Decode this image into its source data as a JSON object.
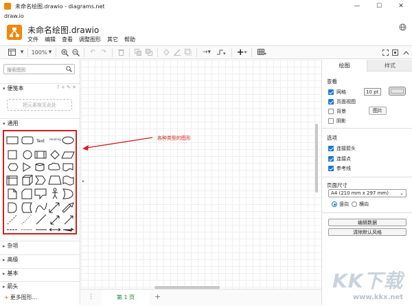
{
  "window": {
    "title": "未命名绘图.drawio - diagrams.net",
    "subtitle": "draw.io",
    "controls": {
      "minimize": "—",
      "maximize": "☐",
      "close": "✕"
    }
  },
  "header": {
    "filename": "未命名绘图.drawio",
    "menu": [
      "文件",
      "编辑",
      "查看",
      "调整图形",
      "其它",
      "帮助"
    ],
    "icons": [
      "drawio-logo-icon",
      "globe-icon"
    ]
  },
  "toolbar": {
    "zoom": "100%",
    "zoom_caret": "▾",
    "icons": [
      "view-toggle-icon",
      "zoom-in-icon",
      "zoom-out-icon",
      "undo-icon",
      "redo-icon",
      "delete-icon",
      "to-front-icon",
      "to-back-icon",
      "fill-color-icon",
      "line-color-icon",
      "shadow-icon",
      "connection-icon",
      "waypoint-icon",
      "insert-icon",
      "table-icon",
      "fullscreen-icon",
      "fit-icon",
      "collapse-icon"
    ]
  },
  "left_panel": {
    "search_placeholder": "搜索图形",
    "scratchpad": {
      "label": "便笺本",
      "tools": "? + ✎ ✕",
      "drop_hint": "把元素拖至此处"
    },
    "general": {
      "label": "通用"
    },
    "general_shape_text": {
      "text": "Text",
      "heading": "Heading"
    },
    "other_sections": [
      {
        "label": "杂项"
      },
      {
        "label": "高级"
      },
      {
        "label": "基本"
      },
      {
        "label": "箭头"
      }
    ],
    "more_shapes": "更多图形..."
  },
  "canvas": {
    "annotation": "各种类型的图形",
    "annotation_color": "#d41c1c"
  },
  "page_bar": {
    "dots": "⋮",
    "page_tab": "第 1 页",
    "add": "+"
  },
  "format_panel": {
    "tabs": [
      "绘图",
      "样式"
    ],
    "view": {
      "heading": "查看",
      "grid_label": "网格",
      "grid_checked": true,
      "grid_size": "10 pt",
      "page_view_label": "页面视图",
      "page_view_checked": true,
      "background_label": "背景",
      "background_checked": false,
      "image_button": "图片",
      "shadow_label": "阴影",
      "shadow_checked": false
    },
    "options": {
      "heading": "选项",
      "items": [
        {
          "label": "连接箭头",
          "checked": true
        },
        {
          "label": "连接点",
          "checked": true
        },
        {
          "label": "参考线",
          "checked": true
        }
      ]
    },
    "paper": {
      "heading": "页面尺寸",
      "size": "A4 (210 mm x 297 mm)",
      "portrait": "竖向",
      "landscape": "横向",
      "orientation": "portrait"
    },
    "buttons": {
      "edit_data": "编辑数据",
      "clear_style": "清除默认风格"
    }
  },
  "watermark": {
    "text": "KK下载",
    "url": "www.kkx.net"
  },
  "colors": {
    "accent": "#f08705",
    "highlight": "#d41c1c",
    "check": "#1976d2",
    "page_tab": "#1a7f3c"
  }
}
